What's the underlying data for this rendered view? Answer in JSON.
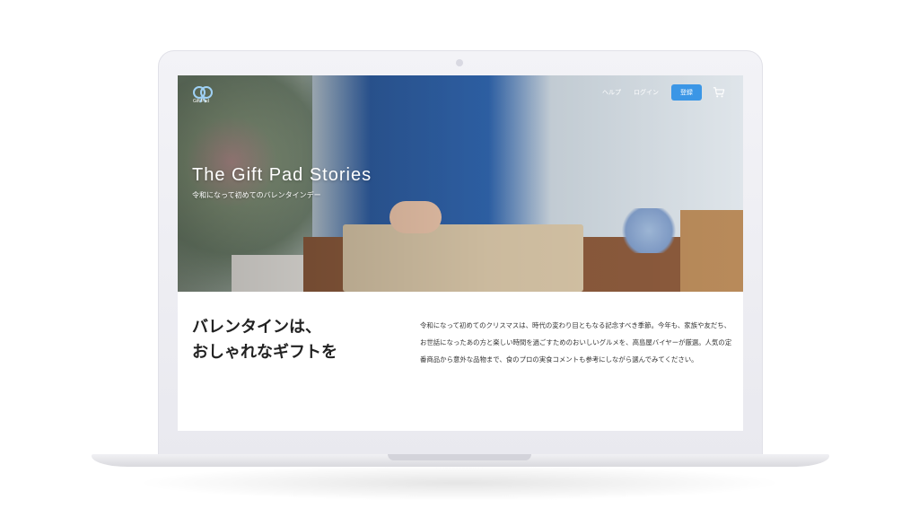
{
  "header": {
    "logo_text": "Gift Pad",
    "nav": {
      "help_label": "ヘルプ",
      "login_label": "ログイン",
      "register_label": "登録"
    },
    "cart_icon": "cart-icon"
  },
  "hero": {
    "title": "The Gift Pad Stories",
    "subtitle": "令和になって初めてのバレンタインデー"
  },
  "article": {
    "heading_line1": "バレンタインは、",
    "heading_line2": "おしゃれなギフトを",
    "body": "令和になって初めてのクリスマスは、時代の変わり目ともなる記念すべき季節。今年も、家族や友だち、お世話になったあの方と楽しい時間を過ごすためのおいしいグルメを、高島屋バイヤーが厳選。人気の定番商品から意外な品物まで、食のプロの実食コメントも参考にしながら選んでみてください。"
  },
  "colors": {
    "accent": "#3b96e6",
    "heading_text": "#222222",
    "body_text": "#333333"
  }
}
